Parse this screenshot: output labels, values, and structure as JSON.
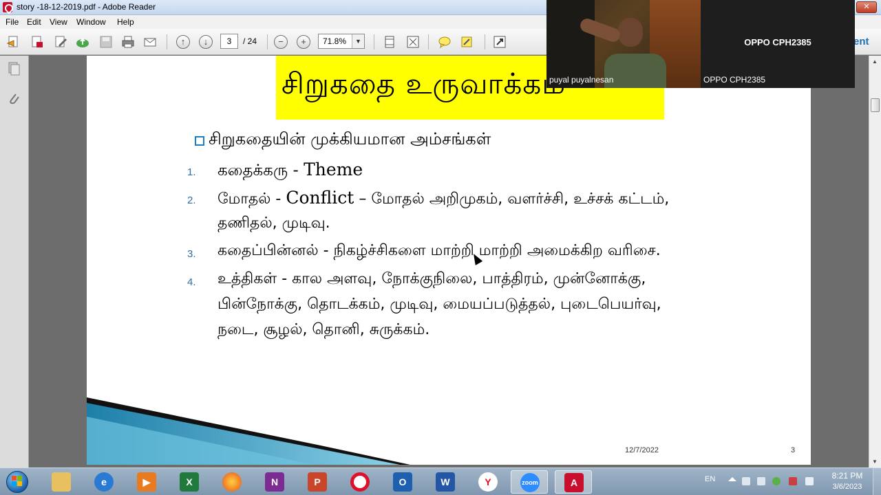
{
  "window": {
    "title": "story -18-12-2019.pdf - Adobe Reader",
    "close_label": "✕"
  },
  "menu": [
    "File",
    "Edit",
    "View",
    "Window",
    "Help"
  ],
  "toolbar": {
    "current_page": "3",
    "total_pages": "/ 24",
    "zoom": "71.8%",
    "zoom_arrow": "▼",
    "zoom_out": "−",
    "zoom_in": "+",
    "prev_page": "↑",
    "next_page": "↓"
  },
  "side_panel_text": "ent",
  "slide": {
    "title": "சிறுகதை உருவாக்கம்",
    "heading": "சிறுகதையின் முக்கியமான அம்சங்கள்",
    "items": [
      {
        "num": "1.",
        "tamil": "கதைக்கரு  -  ",
        "latin": "Theme",
        "rest": "",
        "line2": ""
      },
      {
        "num": "2.",
        "tamil": "மோதல்  -  ",
        "latin": "Conflict",
        "rest": " – மோதல்  அறிமுகம்,  வளர்ச்சி,  உச்சக்  கட்டம்,",
        "line2": "தணிதல்,  முடிவு."
      },
      {
        "num": "3.",
        "tamil": "கதைப்பின்னல்  -  நிகழ்ச்சிகளை  மாற்றி  மாற்றி  அமைக்கிற  வரிசை.",
        "latin": "",
        "rest": "",
        "line2": ""
      },
      {
        "num": "4.",
        "tamil": "உத்திகள்  -  கால  அளவு,  நோக்குநிலை,  பாத்திரம்,  முன்னோக்கு,",
        "latin": "",
        "rest": "",
        "line2": "பின்நோக்கு,  தொடக்கம்,  முடிவு,  மையப்படுத்தல்,  புடைபெயர்வு,",
        "line3": "நடை,  சூழல்,  தொனி,  சுருக்கம்."
      }
    ],
    "footer_date": "12/7/2022",
    "footer_page": "3",
    "colors": {
      "banner": "#ffff00",
      "number": "#2e6da4",
      "bullet": "#1a7fc6"
    }
  },
  "zoom_meeting": {
    "participant_video_name": "puyal puyalnesan",
    "other_center_name": "OPPO CPH2385",
    "other_label": "OPPO CPH2385"
  },
  "taskbar": {
    "apps": [
      "explorer-icon",
      "internet-explorer-icon",
      "media-player-icon",
      "excel-icon",
      "firefox-icon",
      "onenote-icon",
      "powerpoint-icon",
      "opera-icon",
      "outlook-icon",
      "word-icon",
      "yandex-icon",
      "zoom-icon",
      "acrobat-icon"
    ],
    "zoom_label": "zoom",
    "lang": "EN",
    "time": "8:21 PM",
    "date": "3/6/2023"
  }
}
